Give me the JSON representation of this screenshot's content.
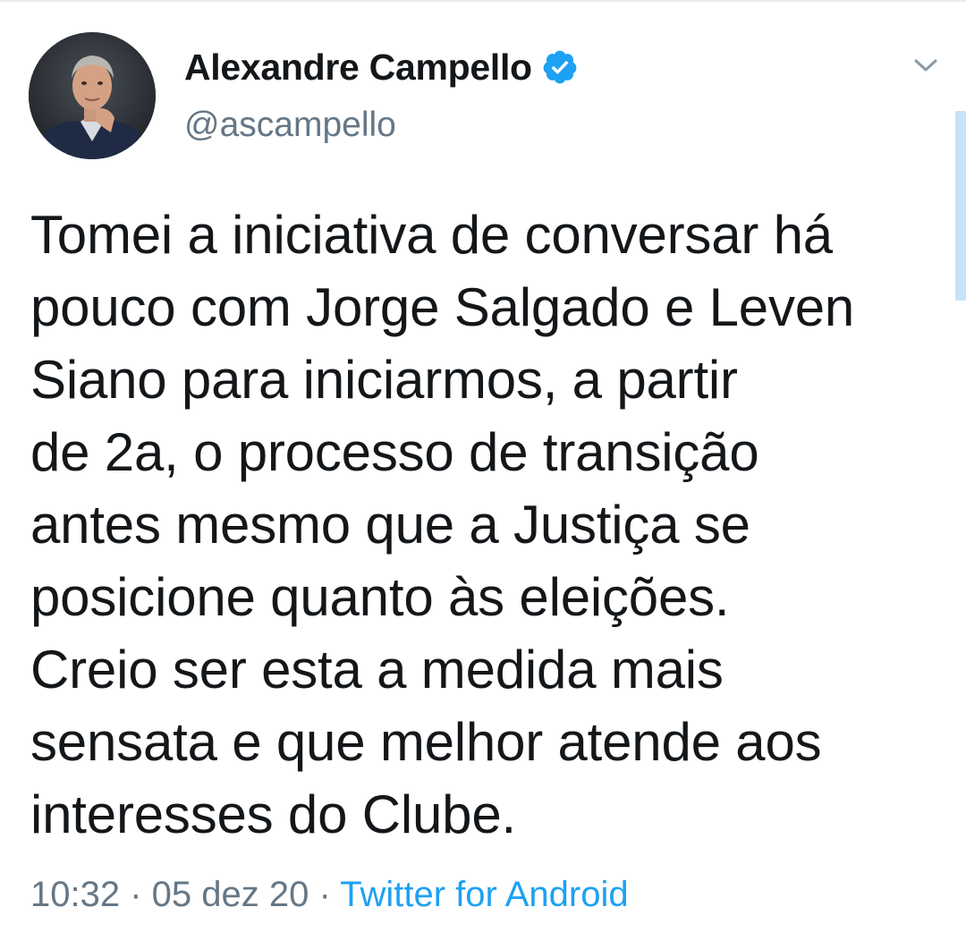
{
  "author": {
    "display_name": "Alexandre Campello",
    "handle": "@ascampello",
    "verified_icon": "verified-badge-icon",
    "accent_color": "#1da1f2"
  },
  "tweet": {
    "lines": [
      "Tomei a iniciativa de conversar há",
      "pouco com Jorge Salgado e Leven",
      "Siano para iniciarmos, a partir",
      "de 2a, o processo de transição",
      "antes mesmo que a Justiça se",
      "posicione quanto às eleições.",
      "Creio ser esta a medida mais",
      "sensata e que melhor atende aos",
      "interesses do Clube."
    ]
  },
  "meta": {
    "time": "10:32",
    "separator": "·",
    "date": "05 dez 20",
    "source": "Twitter for Android"
  },
  "icons": {
    "menu": "chevron-down-icon"
  }
}
